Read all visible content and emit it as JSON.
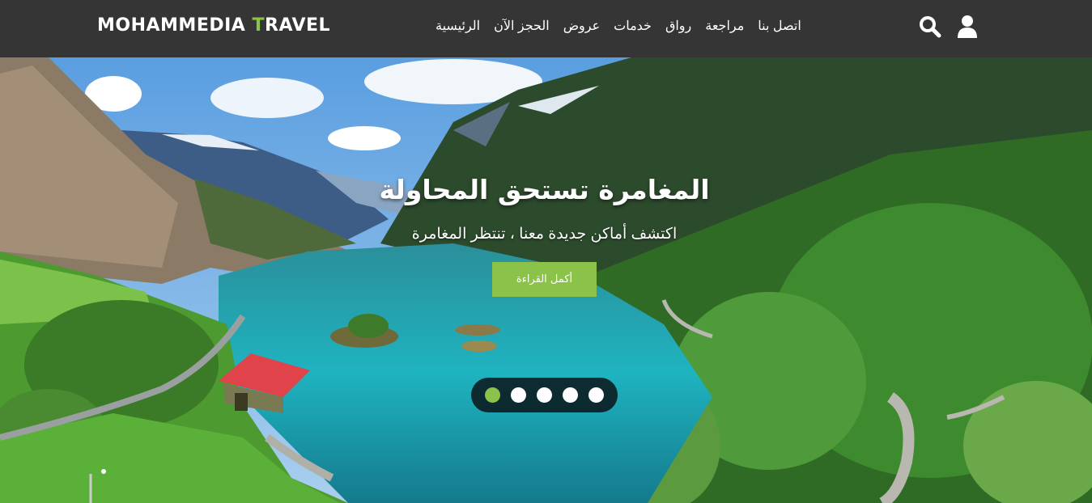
{
  "brand": {
    "part1": "MOHAMMEDIA ",
    "accent": "T",
    "part2": "RAVEL"
  },
  "nav": {
    "items": [
      {
        "label": "الرئيسية",
        "id": "home"
      },
      {
        "label": "الحجز الآن",
        "id": "book-now"
      },
      {
        "label": "عروض",
        "id": "offers"
      },
      {
        "label": "خدمات",
        "id": "services"
      },
      {
        "label": "رواق",
        "id": "gallery"
      },
      {
        "label": "مراجعة",
        "id": "review"
      },
      {
        "label": "اتصل بنا",
        "id": "contact"
      }
    ],
    "icons": [
      "search-icon",
      "user-icon"
    ]
  },
  "hero": {
    "title": "المغامرة تستحق المحاولة",
    "subtitle": "اكتشف أماكن جديدة معنا ، تنتظر المغامرة",
    "button_label": "أكمل القراءة",
    "slides_count": 5,
    "active_slide": 1
  },
  "colors": {
    "navbar_bg": "#353535",
    "accent": "#8bc34a",
    "text": "#ffffff"
  }
}
